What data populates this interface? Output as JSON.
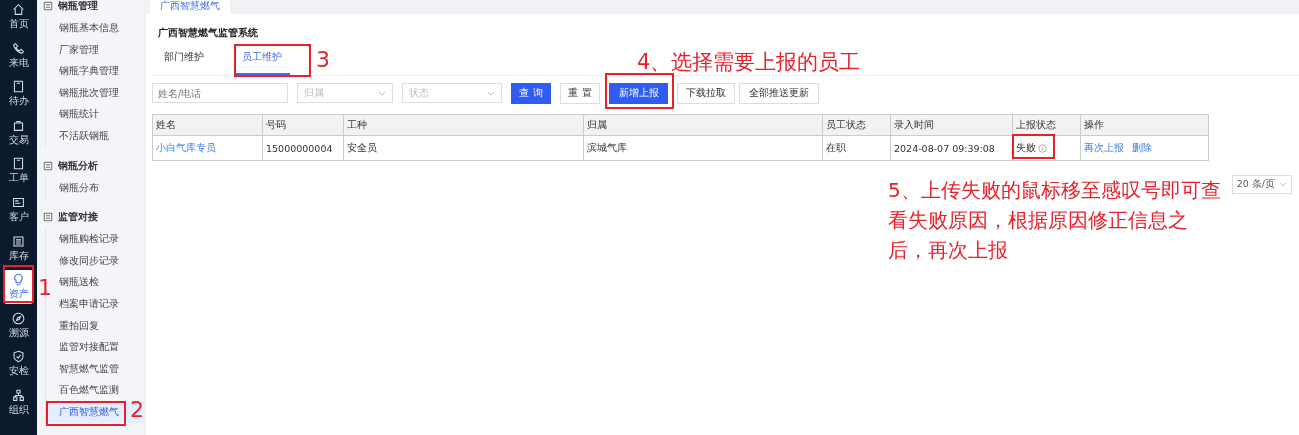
{
  "rail": [
    {
      "label": "首页",
      "selected": false
    },
    {
      "label": "来电",
      "selected": false
    },
    {
      "label": "待办",
      "selected": false
    },
    {
      "label": "交易",
      "selected": false
    },
    {
      "label": "工单",
      "selected": false
    },
    {
      "label": "客户",
      "selected": false
    },
    {
      "label": "库存",
      "selected": false
    },
    {
      "label": "资产",
      "selected": true
    },
    {
      "label": "溯源",
      "selected": false
    },
    {
      "label": "安检",
      "selected": false
    },
    {
      "label": "组织",
      "selected": false
    }
  ],
  "submenu": [
    {
      "title": "钢瓶管理",
      "items": [
        {
          "label": "钢瓶基本信息",
          "selected": false
        },
        {
          "label": "厂家管理",
          "selected": false
        },
        {
          "label": "钢瓶字典管理",
          "selected": false
        },
        {
          "label": "钢瓶批次管理",
          "selected": false
        },
        {
          "label": "钢瓶统计",
          "selected": false
        },
        {
          "label": "不活跃钢瓶",
          "selected": false
        }
      ]
    },
    {
      "title": "钢瓶分析",
      "items": [
        {
          "label": "钢瓶分布",
          "selected": false
        }
      ]
    },
    {
      "title": "监管对接",
      "items": [
        {
          "label": "钢瓶购检记录",
          "selected": false
        },
        {
          "label": "修改同步记录",
          "selected": false
        },
        {
          "label": "钢瓶送检",
          "selected": false
        },
        {
          "label": "档案申请记录",
          "selected": false
        },
        {
          "label": "重拍回复",
          "selected": false
        },
        {
          "label": "监管对接配置",
          "selected": false
        },
        {
          "label": "智慧燃气监管",
          "selected": false
        },
        {
          "label": "百色燃气监测",
          "selected": false
        },
        {
          "label": "广西智慧燃气",
          "selected": true
        }
      ]
    }
  ],
  "page_tab": "广西智慧燃气",
  "panel_title": "广西智慧燃气监管系统",
  "tabs": [
    {
      "label": "部门维护",
      "selected": false
    },
    {
      "label": "员工维护",
      "selected": true
    }
  ],
  "filters": [
    {
      "kind": "input",
      "placeholder": "姓名/电话"
    },
    {
      "kind": "select",
      "placeholder": "归属"
    },
    {
      "kind": "select",
      "placeholder": "状态"
    }
  ],
  "buttons": [
    {
      "label": "查 询",
      "primary": true
    },
    {
      "label": "重 置",
      "primary": false
    },
    {
      "label": "新增上报",
      "primary": true
    },
    {
      "label": "下载拉取",
      "primary": false
    },
    {
      "label": "全部推送更新",
      "primary": false
    }
  ],
  "table": {
    "columns": [
      "姓名",
      "号码",
      "工种",
      "归属",
      "员工状态",
      "录入时间",
      "上报状态",
      "操作"
    ],
    "rows": [
      {
        "name": "小白气库专员",
        "phone": "15000000004",
        "job": "安全员",
        "owner": "滨城气库",
        "status": "在职",
        "time": "2024-08-07 09:39:08",
        "report": "失败",
        "actions": [
          "再次上报",
          "删除"
        ]
      }
    ]
  },
  "page_size": "20 条/页",
  "annotations": [
    "1",
    "2",
    "3",
    "4、选择需要上报的员工",
    "5、上传失败的鼠标移至感叹号即可查看失败原因，根据原因修正信息之后，再次上报"
  ]
}
